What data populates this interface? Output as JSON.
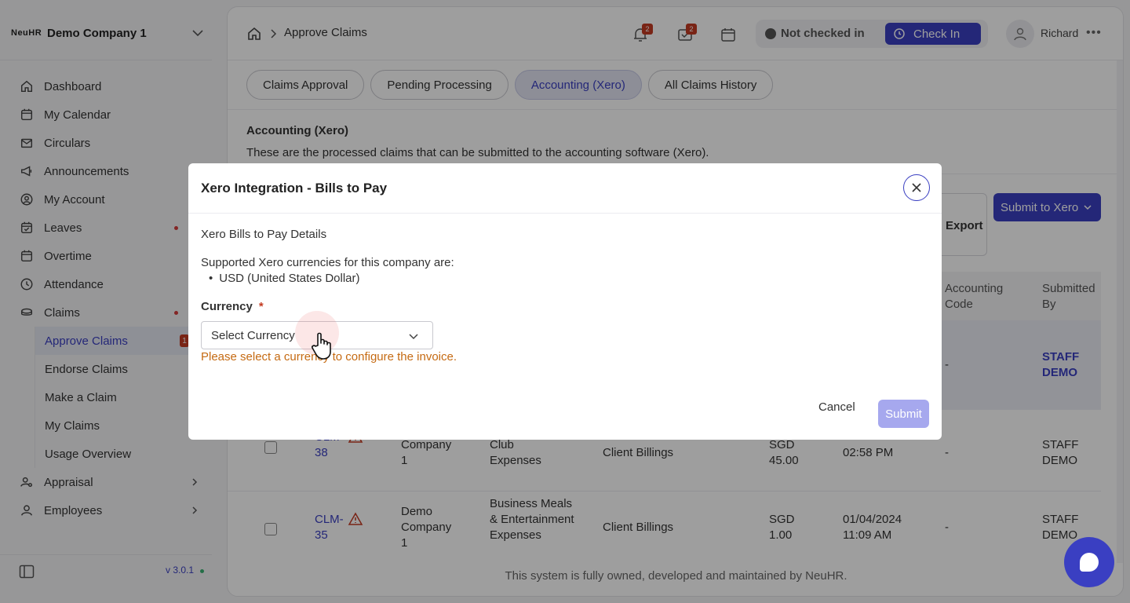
{
  "sidebar": {
    "logo": "NeuHR",
    "company": "Demo Company 1",
    "items": [
      {
        "label": "Dashboard",
        "icon": "home-icon"
      },
      {
        "label": "My Calendar",
        "icon": "calendar-icon"
      },
      {
        "label": "Circulars",
        "icon": "mail-icon"
      },
      {
        "label": "Announcements",
        "icon": "megaphone-icon"
      },
      {
        "label": "My Account",
        "icon": "user-circle-icon"
      },
      {
        "label": "Leaves",
        "icon": "calendar-check-icon"
      },
      {
        "label": "Overtime",
        "icon": "calendar-icon"
      },
      {
        "label": "Attendance",
        "icon": "clock-icon"
      },
      {
        "label": "Claims",
        "icon": "coins-icon"
      }
    ],
    "claims_sub": [
      {
        "label": "Approve Claims",
        "badge": "1"
      },
      {
        "label": "Endorse Claims"
      },
      {
        "label": "Make a Claim"
      },
      {
        "label": "My Claims"
      },
      {
        "label": "Usage Overview"
      }
    ],
    "after_items": [
      {
        "label": "Appraisal",
        "icon": "user-gear-icon"
      },
      {
        "label": "Employees",
        "icon": "user-icon"
      }
    ],
    "version": "v 3.0.1"
  },
  "topbar": {
    "breadcrumb": "Approve Claims",
    "notif_badge": "2",
    "tasks_badge": "2",
    "status": "Not checked in",
    "checkin_label": "Check In",
    "user": "Richard"
  },
  "tabs": [
    {
      "label": "Claims Approval"
    },
    {
      "label": "Pending Processing"
    },
    {
      "label": "Accounting (Xero)"
    },
    {
      "label": "All Claims History"
    }
  ],
  "section": {
    "title": "Accounting (Xero)",
    "desc": "These are the processed claims that can be submitted to the accounting software (Xero)."
  },
  "actions": {
    "export": "Export",
    "submit_xero": "Submit to Xero"
  },
  "table": {
    "headers": {
      "accounting_code": "Accounting Code",
      "submitted_by": "Submitted By"
    },
    "rows": [
      {
        "accounting_code": "-",
        "submitted_by": "STAFF DEMO"
      },
      {
        "id": "CLM-38",
        "company": "Company 1",
        "category": "Club Expenses",
        "type": "Client Billings",
        "amount": "SGD 45.00",
        "date": "02:58 PM",
        "accounting_code": "-",
        "submitted_by": "STAFF DEMO"
      },
      {
        "id": "CLM-35",
        "company": "Demo Company 1",
        "category": "Business Meals & Entertainment Expenses",
        "type": "Client Billings",
        "amount": "SGD 1.00",
        "date": "01/04/2024 11:09 AM",
        "accounting_code": "-",
        "submitted_by": "STAFF DEMO"
      }
    ]
  },
  "footer": "This system is fully owned, developed and maintained by NeuHR.",
  "modal": {
    "title": "Xero Integration - Bills to Pay",
    "details_heading": "Xero Bills to Pay Details",
    "supported_text": "Supported Xero currencies for this company are:",
    "currencies": [
      "USD (United States Dollar)"
    ],
    "currency_label": "Currency",
    "required_mark": "*",
    "select_placeholder": "Select Currency",
    "error": "Please select a currency to configure the invoice.",
    "cancel": "Cancel",
    "submit": "Submit"
  },
  "colors": {
    "accent": "#3a3fc2",
    "error": "#c56a12",
    "badge": "#c43b22"
  }
}
